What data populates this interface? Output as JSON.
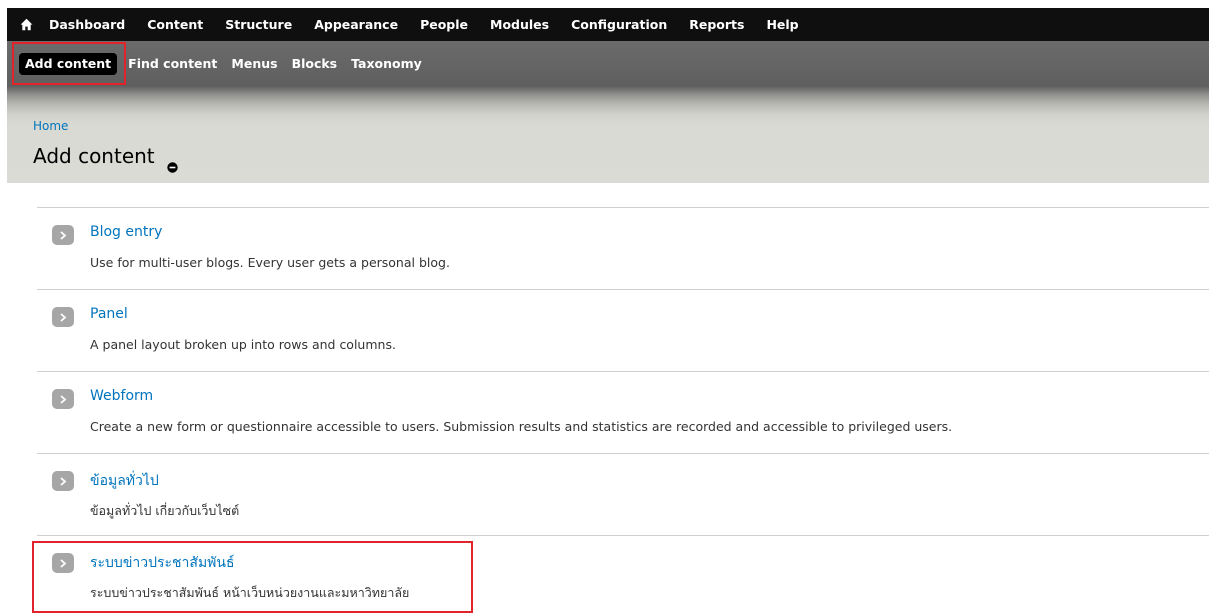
{
  "toolbar": {
    "items": [
      {
        "label": "Dashboard"
      },
      {
        "label": "Content"
      },
      {
        "label": "Structure"
      },
      {
        "label": "Appearance"
      },
      {
        "label": "People"
      },
      {
        "label": "Modules"
      },
      {
        "label": "Configuration"
      },
      {
        "label": "Reports"
      },
      {
        "label": "Help"
      }
    ]
  },
  "shortcuts": {
    "items": [
      {
        "label": "Add content",
        "active": true
      },
      {
        "label": "Find content"
      },
      {
        "label": "Menus"
      },
      {
        "label": "Blocks"
      },
      {
        "label": "Taxonomy"
      }
    ]
  },
  "header": {
    "breadcrumb": "Home",
    "title": "Add content"
  },
  "content_types": [
    {
      "title": "Blog entry",
      "description": "Use for multi-user blogs. Every user gets a personal blog."
    },
    {
      "title": "Panel",
      "description": "A panel layout broken up into rows and columns."
    },
    {
      "title": "Webform",
      "description": "Create a new form or questionnaire accessible to users. Submission results and statistics are recorded and accessible to privileged users."
    },
    {
      "title": "ข้อมูลทั่วไป",
      "description": "ข้อมูลทั่วไป เกี่ยวกับเว็บไซต์"
    },
    {
      "title": "ระบบข่าวประชาสัมพันธ์",
      "description": "ระบบข่าวประชาสัมพันธ์ หน้าเว็บหน่วยงานและมหาวิทยาลัย"
    }
  ],
  "colors": {
    "link": "#0074bd",
    "toolbar_bg": "#0f0f0f",
    "highlight": "#e2232a"
  },
  "icons": {
    "home": "home-icon",
    "expand": "chevron-right-icon",
    "shortcut": "remove-shortcut-icon"
  }
}
